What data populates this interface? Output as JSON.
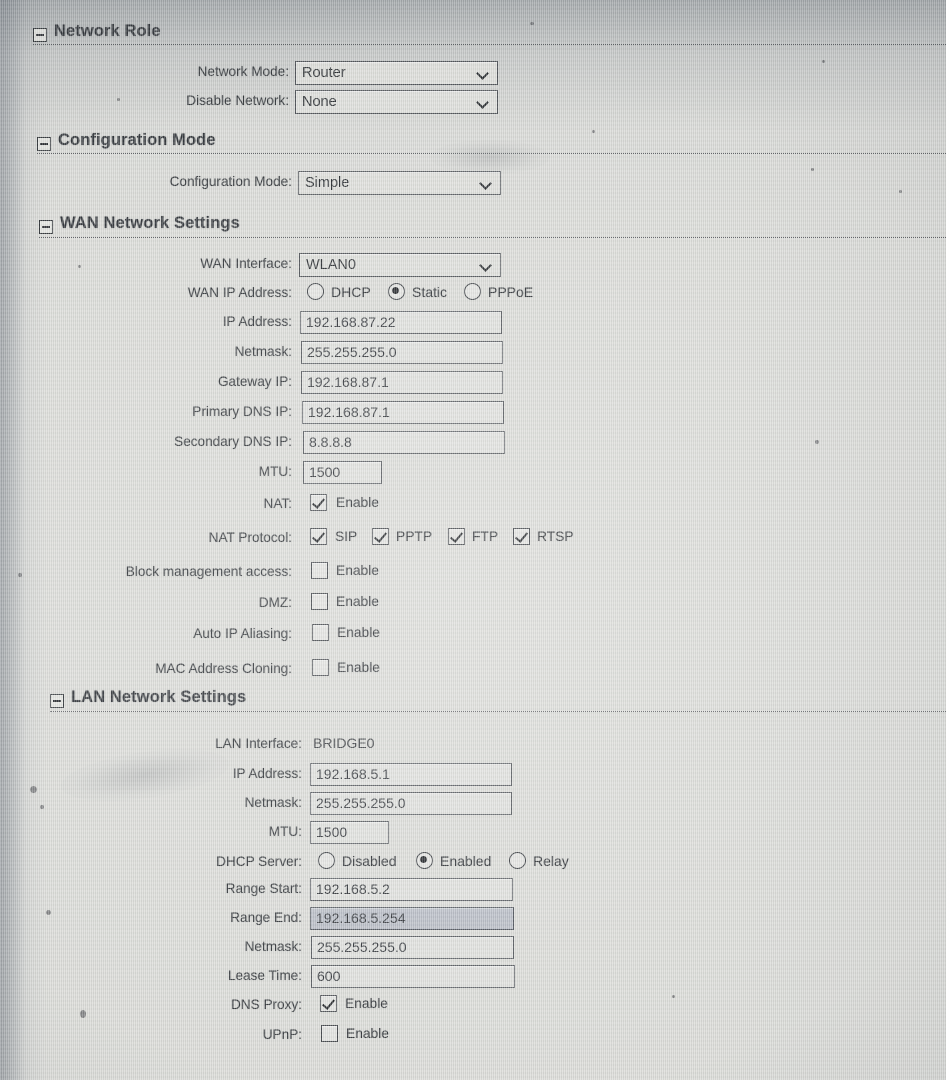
{
  "sections": {
    "network_role": {
      "title": "Network Role",
      "toggle_icon": "collapse-minus-icon",
      "fields": {
        "network_mode": {
          "label": "Network Mode:",
          "value": "Router"
        },
        "disable_network": {
          "label": "Disable Network:",
          "value": "None"
        }
      }
    },
    "configuration_mode": {
      "title": "Configuration Mode",
      "toggle_icon": "collapse-minus-icon",
      "fields": {
        "configuration_mode": {
          "label": "Configuration Mode:",
          "value": "Simple"
        }
      }
    },
    "wan": {
      "title": "WAN Network Settings",
      "toggle_icon": "collapse-minus-icon",
      "fields": {
        "wan_interface": {
          "label": "WAN Interface:",
          "value": "WLAN0"
        },
        "wan_ip_address": {
          "label": "WAN IP Address:",
          "options": [
            "DHCP",
            "Static",
            "PPPoE"
          ],
          "selected": "Static"
        },
        "ip_address": {
          "label": "IP Address:",
          "value": "192.168.87.22"
        },
        "netmask": {
          "label": "Netmask:",
          "value": "255.255.255.0"
        },
        "gateway_ip": {
          "label": "Gateway IP:",
          "value": "192.168.87.1"
        },
        "primary_dns_ip": {
          "label": "Primary DNS IP:",
          "value": "192.168.87.1"
        },
        "secondary_dns_ip": {
          "label": "Secondary DNS IP:",
          "value": "8.8.8.8"
        },
        "mtu": {
          "label": "MTU:",
          "value": "1500"
        },
        "nat": {
          "label": "NAT:",
          "checkbox_label": "Enable",
          "checked": true
        },
        "nat_protocol": {
          "label": "NAT Protocol:",
          "items": [
            {
              "label": "SIP",
              "checked": true
            },
            {
              "label": "PPTP",
              "checked": true
            },
            {
              "label": "FTP",
              "checked": true
            },
            {
              "label": "RTSP",
              "checked": true
            }
          ]
        },
        "block_management_access": {
          "label": "Block management access:",
          "checkbox_label": "Enable",
          "checked": false
        },
        "dmz": {
          "label": "DMZ:",
          "checkbox_label": "Enable",
          "checked": false
        },
        "auto_ip_aliasing": {
          "label": "Auto IP Aliasing:",
          "checkbox_label": "Enable",
          "checked": false
        },
        "mac_address_cloning": {
          "label": "MAC Address Cloning:",
          "checkbox_label": "Enable",
          "checked": false
        }
      }
    },
    "lan": {
      "title": "LAN Network Settings",
      "toggle_icon": "collapse-minus-icon",
      "fields": {
        "lan_interface": {
          "label": "LAN Interface:",
          "value": "BRIDGE0"
        },
        "ip_address": {
          "label": "IP Address:",
          "value": "192.168.5.1"
        },
        "netmask": {
          "label": "Netmask:",
          "value": "255.255.255.0"
        },
        "mtu": {
          "label": "MTU:",
          "value": "1500"
        },
        "dhcp_server": {
          "label": "DHCP Server:",
          "options": [
            "Disabled",
            "Enabled",
            "Relay"
          ],
          "selected": "Enabled"
        },
        "range_start": {
          "label": "Range Start:",
          "value": "192.168.5.2"
        },
        "range_end": {
          "label": "Range End:",
          "value": "192.168.5.254",
          "selected": true
        },
        "dhcp_netmask": {
          "label": "Netmask:",
          "value": "255.255.255.0"
        },
        "lease_time": {
          "label": "Lease Time:",
          "value": "600"
        },
        "dns_proxy": {
          "label": "DNS Proxy:",
          "checkbox_label": "Enable",
          "checked": true
        },
        "upnp": {
          "label": "UPnP:",
          "checkbox_label": "Enable",
          "checked": false
        }
      }
    }
  },
  "colors": {
    "page_background": "#d9dad6",
    "field_background": "#dddedb",
    "field_selected_background": "#b4b9c2",
    "text": "#2d3135",
    "border": "#54585d"
  }
}
